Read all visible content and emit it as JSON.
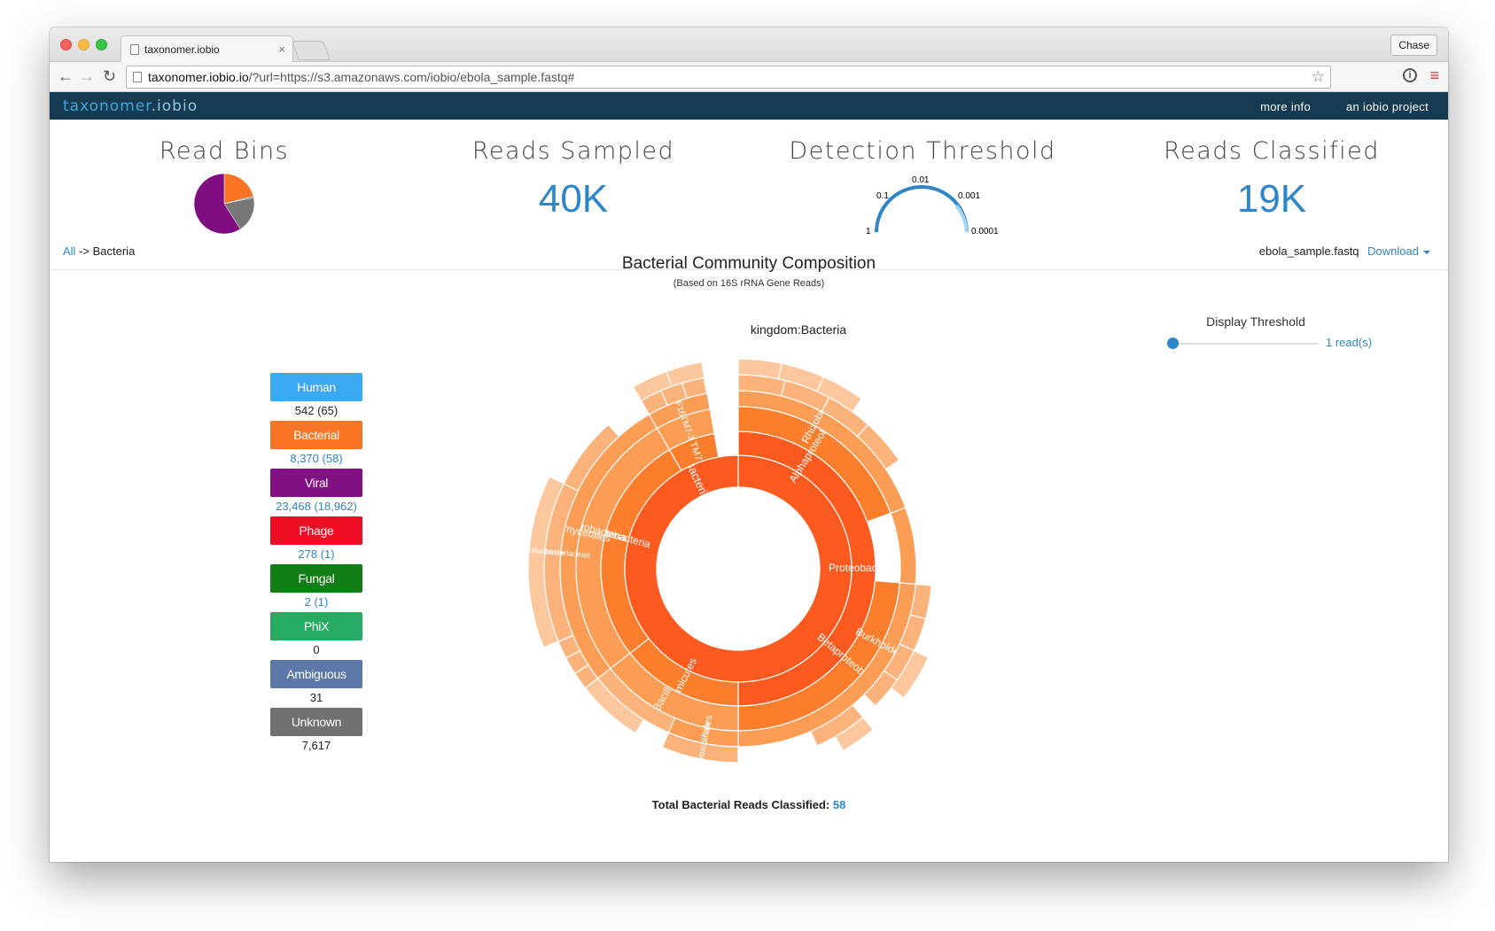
{
  "browser": {
    "tab_title": "taxonomer.iobio",
    "tab_close": "×",
    "profile": "Chase",
    "url_host": "taxonomer.iobio.io",
    "url_path": "/?url=https://s3.amazonaws.com/iobio/ebola_sample.fastq#"
  },
  "nav": {
    "brand_main": "taxonomer",
    "brand_dot": ".iobio",
    "more_info": "more info",
    "project": "an iobio project"
  },
  "stats": {
    "read_bins_title": "Read Bins",
    "reads_sampled_title": "Reads Sampled",
    "reads_sampled_value": "40K",
    "threshold_title": "Detection Threshold",
    "threshold_ticks": [
      "1",
      "0.1",
      "0.01",
      "0.001",
      "0.0001"
    ],
    "reads_classified_title": "Reads Classified",
    "reads_classified_value": "19K"
  },
  "read_bins_pie": [
    {
      "name": "Bacterial",
      "value": 8370,
      "color": "#f97424"
    },
    {
      "name": "PhiX",
      "value": 5,
      "color": "#1f7fd1"
    },
    {
      "name": "Ambiguous",
      "value": 300,
      "color": "#5c78a8"
    },
    {
      "name": "Unknown",
      "value": 7617,
      "color": "#777777"
    },
    {
      "name": "Viral",
      "value": 23468,
      "color": "#7f0d81"
    }
  ],
  "breadcrumb": {
    "root": "All",
    "sep": " -> ",
    "current": "Bacteria"
  },
  "file": {
    "name": "ebola_sample.fastq",
    "download": "Download"
  },
  "chart": {
    "title": "Bacterial Community Composition",
    "subtitle": "(Based on 16S rRNA Gene Reads)",
    "hover_label": "kingdom:Bacteria",
    "total_label": "Total Bacterial Reads Classified: ",
    "total_value": "58"
  },
  "threshold_slider": {
    "label": "Display Threshold",
    "value": "1 read(s)"
  },
  "bins": [
    {
      "label": "Human",
      "count": "542 (65)",
      "color": "#3aa8f3",
      "count_style": "dark"
    },
    {
      "label": "Bacterial",
      "count": "8,370 (58)",
      "color": "#f97424",
      "count_style": "blue"
    },
    {
      "label": "Viral",
      "count": "23,468 (18,962)",
      "color": "#820f83",
      "count_style": "blue"
    },
    {
      "label": "Phage",
      "count": "278 (1)",
      "color": "#ee0d24",
      "count_style": "blue"
    },
    {
      "label": "Fungal",
      "count": "2 (1)",
      "color": "#107e14",
      "count_style": "blue"
    },
    {
      "label": "PhiX",
      "count": "0",
      "color": "#27ab62",
      "count_style": "dark"
    },
    {
      "label": "Ambiguous",
      "count": "31",
      "color": "#5c78a8",
      "count_style": "dark"
    },
    {
      "label": "Unknown",
      "count": "7,617",
      "color": "#717171",
      "count_style": "dark"
    }
  ],
  "sunburst_labels": {
    "root": "Bacteria",
    "proteobacteria": "Proteobacteria",
    "alphaproteobacteria": "Alphaproteobacteria",
    "rhizobiales": "Rhizobiales",
    "betaproteobacteria": "Betaproteobacteria",
    "burkholderiales": "Burkholderiales",
    "firmicutes": "Firmicutes",
    "bacilli": "Bacilli",
    "bacillales": "Bacillales",
    "exiguobacterium": "Exiguobacterium",
    "actinobacteria_phylum": "Actinobacteria",
    "actinobacteria_class": "Actinobacteria",
    "actinomycetales": "Actinomycetales",
    "propionibacteriaceae": "Propionibacteriaceae",
    "propionibacterium": "Propionibacterium",
    "tm7": "TM7",
    "tm7_3": "TM7-3",
    "f16": "F16"
  }
}
